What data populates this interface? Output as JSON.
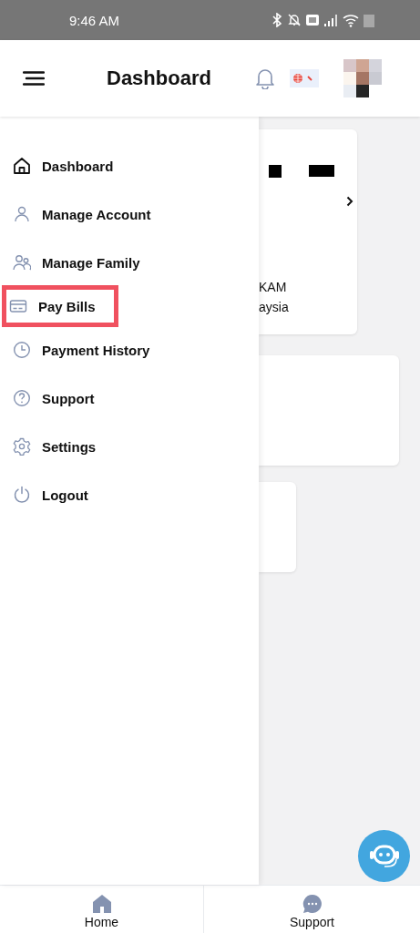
{
  "status_bar": {
    "time": "9:46 AM"
  },
  "header": {
    "title": "Dashboard"
  },
  "drawer": {
    "items": [
      {
        "label": "Dashboard",
        "highlighted": false
      },
      {
        "label": "Manage Account",
        "highlighted": false
      },
      {
        "label": "Manage Family",
        "highlighted": false
      },
      {
        "label": "Pay Bills",
        "highlighted": true
      },
      {
        "label": "Payment History",
        "highlighted": false
      },
      {
        "label": "Support",
        "highlighted": false
      },
      {
        "label": "Settings",
        "highlighted": false
      },
      {
        "label": "Logout",
        "highlighted": false
      }
    ]
  },
  "background_card": {
    "line_1": "KAM",
    "line_2": "aysia"
  },
  "bottom_nav": [
    {
      "label": "Home"
    },
    {
      "label": "Support"
    }
  ]
}
